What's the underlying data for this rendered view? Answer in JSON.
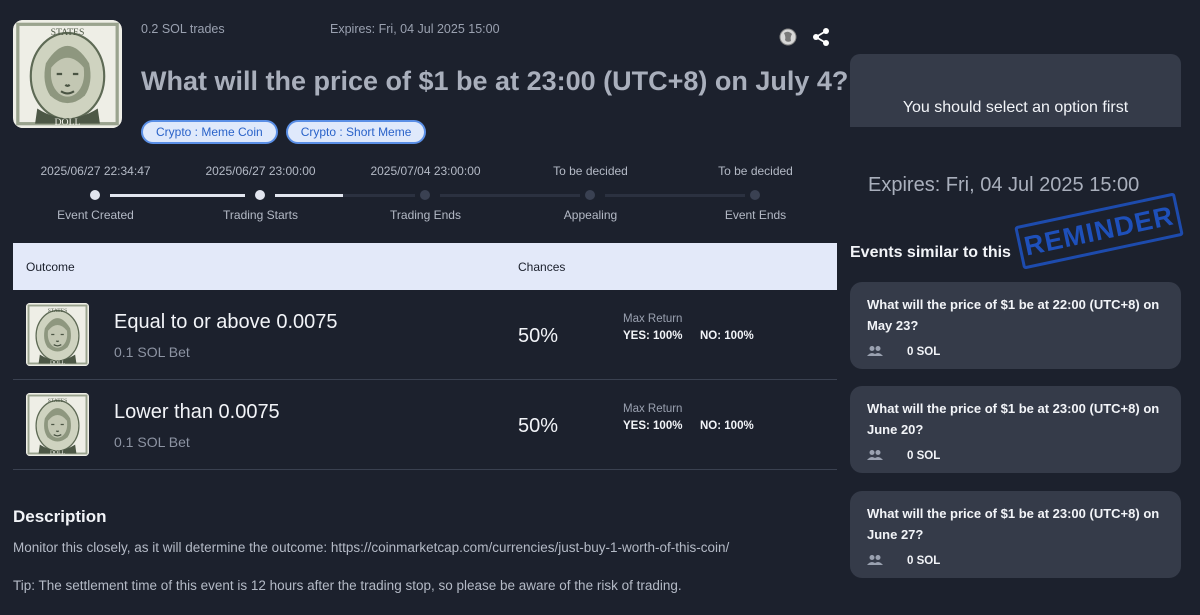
{
  "header": {
    "trades": "0.2 SOL trades",
    "expires": "Expires: Fri, 04 Jul 2025 15:00",
    "title": "What will the price of $1 be at 23:00 (UTC+8) on July 4?",
    "tags": [
      "Crypto : Meme Coin",
      "Crypto : Short Meme"
    ],
    "icons": [
      "globe-icon",
      "share-icon"
    ]
  },
  "timeline": [
    {
      "date": "2025/06/27 22:34:47",
      "label": "Event Created"
    },
    {
      "date": "2025/06/27 23:00:00",
      "label": "Trading Starts"
    },
    {
      "date": "2025/07/04 23:00:00",
      "label": "Trading Ends"
    },
    {
      "date": "To be decided",
      "label": "Appealing"
    },
    {
      "date": "To be decided",
      "label": "Event Ends"
    }
  ],
  "table": {
    "col_outcome": "Outcome",
    "col_chances": "Chances",
    "rows": [
      {
        "title": "Equal to or above 0.0075",
        "bet": "0.1 SOL Bet",
        "chance": "50%",
        "max_return": "Max Return",
        "yes": "YES: 100%",
        "no": "NO: 100%"
      },
      {
        "title": "Lower than 0.0075",
        "bet": "0.1 SOL Bet",
        "chance": "50%",
        "max_return": "Max Return",
        "yes": "YES: 100%",
        "no": "NO: 100%"
      }
    ]
  },
  "description": {
    "heading": "Description",
    "text": "Monitor this closely, as it will determine the outcome: https://coinmarketcap.com/currencies/just-buy-1-worth-of-this-coin/",
    "tip": "Tip: The settlement time of this event is 12 hours after the trading stop, so please be aware of the risk of trading."
  },
  "sidebar": {
    "select_prompt": "You should select an option first",
    "expires": "Expires: Fri, 04 Jul 2025 15:00",
    "stamp": "REMINDER",
    "similar_heading": "Events similar to this",
    "similar": [
      {
        "title": "What will the price of $1 be at 22:00 (UTC+8) on May 23?",
        "sol": "0 SOL"
      },
      {
        "title": "What will the price of $1 be at 23:00 (UTC+8) on June 20?",
        "sol": "0 SOL"
      },
      {
        "title": "What will the price of $1 be at 23:00 (UTC+8) on June 27?",
        "sol": "0 SOL"
      }
    ]
  },
  "colors": {
    "background": "#1c212d",
    "panel": "#353b49",
    "tag_bg": "#dfe9fb",
    "tag_text": "#2a63c9",
    "table_head": "#e3e9f9",
    "stamp": "#1f55c8"
  }
}
